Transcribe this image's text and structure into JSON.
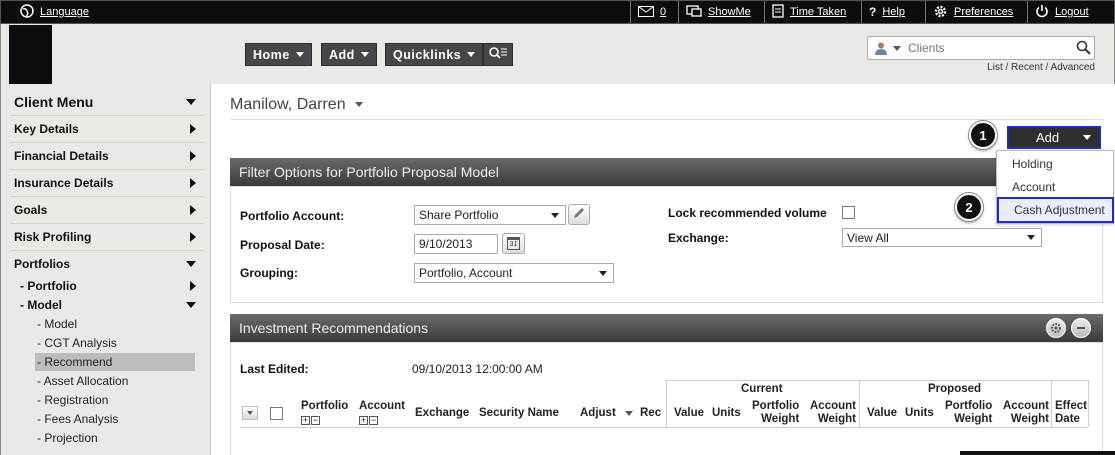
{
  "topbar": {
    "language": "Language",
    "messages_count": "0",
    "showme": "ShowMe",
    "time_taken": "Time Taken",
    "help_symbol": "?",
    "help": "Help",
    "preferences": "Preferences",
    "logout": "Logout"
  },
  "nav": {
    "home": "Home",
    "add": "Add",
    "quicklinks": "Quicklinks"
  },
  "search": {
    "placeholder": "Clients",
    "links": "List / Recent / Advanced"
  },
  "sidebar": {
    "title": "Client Menu",
    "items": [
      {
        "label": "Key Details"
      },
      {
        "label": "Financial Details"
      },
      {
        "label": "Insurance Details"
      },
      {
        "label": "Goals"
      },
      {
        "label": "Risk Profiling"
      },
      {
        "label": "Portfolios"
      }
    ],
    "portfolio": "- Portfolio",
    "model": "- Model",
    "subitems": [
      {
        "label": "- Model"
      },
      {
        "label": "- CGT Analysis"
      },
      {
        "label": "- Recommend"
      },
      {
        "label": "- Asset Allocation"
      },
      {
        "label": "- Registration"
      },
      {
        "label": "- Fees Analysis"
      },
      {
        "label": "- Projection"
      }
    ]
  },
  "client": {
    "name": "Manilow, Darren"
  },
  "add_menu": {
    "button": "Add",
    "items": [
      "Holding",
      "Account",
      "Cash Adjustment"
    ],
    "callout1": "1",
    "callout2": "2"
  },
  "filter": {
    "title": "Filter Options for Portfolio Proposal Model",
    "portfolio_account_label": "Portfolio Account:",
    "portfolio_account_value": "Share Portfolio",
    "proposal_date_label": "Proposal Date:",
    "proposal_date_value": "9/10/2013",
    "calendar_day": "31",
    "grouping_label": "Grouping:",
    "grouping_value": "Portfolio, Account",
    "lock_label": "Lock recommended volume",
    "exchange_label": "Exchange:",
    "exchange_value": "View All"
  },
  "investment": {
    "title": "Investment Recommendations",
    "last_edited_label": "Last Edited:",
    "last_edited_value": "09/10/2013 12:00:00 AM",
    "current_group": "Current",
    "proposed_group": "Proposed",
    "col_portfolio": "Portfolio",
    "col_account": "Account",
    "col_exchange": "Exchange",
    "col_security": "Security Name",
    "col_adjust": "Adjust",
    "col_rec": "Rec",
    "col_value": "Value",
    "col_units": "Units",
    "col_portfolio_weight_1": "Portfolio",
    "col_portfolio_weight_2": "Weight",
    "col_account_weight_1": "Account",
    "col_account_weight_2": "Weight",
    "col_effect_1": "Effect",
    "col_effect_2": "Date"
  }
}
